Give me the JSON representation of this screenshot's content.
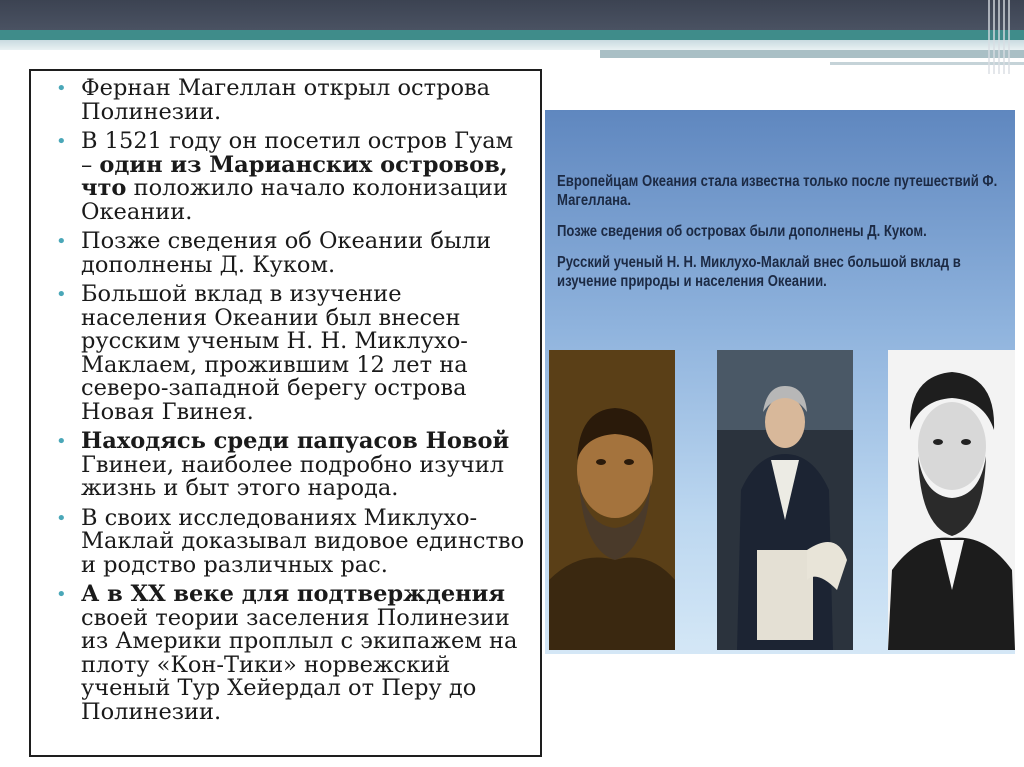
{
  "bullets": [
    {
      "parts": [
        {
          "t": "Фернан Магеллан открыл острова Полинезии.",
          "b": false
        }
      ]
    },
    {
      "parts": [
        {
          "t": " В 1521 году он посетил остров Гуам – ",
          "b": false
        },
        {
          "t": "один из Марианских островов, что",
          "b": true
        },
        {
          "t": " положило начало колонизации Океании.",
          "b": false
        }
      ]
    },
    {
      "parts": [
        {
          "t": " Позже сведения об Океании были дополнены Д. Куком.",
          "b": false
        }
      ]
    },
    {
      "parts": [
        {
          "t": " Большой вклад в изучение населения Океании был внесен русским ученым Н. Н. Миклухо-Маклаем, прожившим 12 лет на северо-западной берегу острова Новая Гвинея.",
          "b": false
        }
      ]
    },
    {
      "parts": [
        {
          "t": "Находясь среди папуасов Новой",
          "b": true
        },
        {
          "t": " Гвинеи, наиболее подробно изучил жизнь и быт этого народа.",
          "b": false
        }
      ]
    },
    {
      "parts": [
        {
          "t": "В своих исследованиях Миклухо-Маклай доказывал видовое единство и родство различных рас.",
          "b": false
        }
      ]
    },
    {
      "parts": [
        {
          "t": "А в XX веке для подтверждения",
          "b": true
        },
        {
          "t": " своей теории заселения Полинезии из Америки проплыл с экипажем на плоту «Кон-Тики» норвежский ученый Тур Хейердал от Перу до Полинезии.",
          "b": false
        }
      ]
    }
  ],
  "picture": {
    "caption_lines": [
      "Европейцам Океания стала известна только после путешествий Ф. Магеллана.",
      "Позже сведения об островах были дополнены Д. Куком.",
      "Русский ученый Н. Н. Миклухо-Маклай внес большой вклад в изучение природы и населения Океании."
    ]
  },
  "colors": {
    "accent": "#4aa7b8",
    "band_teal": "#3f8c8a",
    "band_dark": "#3c4352"
  }
}
